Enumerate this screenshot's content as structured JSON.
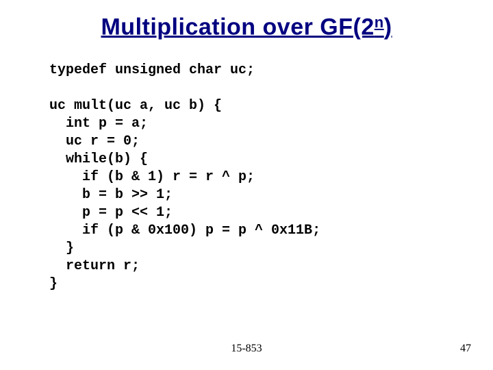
{
  "title": {
    "prefix": "Multiplication over GF(2",
    "sup": "n",
    "suffix": ")"
  },
  "code": {
    "typedef": "typedef unsigned char uc;",
    "blank1": "",
    "func_open": "uc mult(uc a, uc b) {",
    "l1": "  int p = a;",
    "l2": "  uc r = 0;",
    "l3": "  while(b) {",
    "l4": "    if (b & 1) r = r ^ p;",
    "l5": "    b = b >> 1;",
    "l6": "    p = p << 1;",
    "l7": "    if (p & 0x100) p = p ^ 0x11B;",
    "l8": "  }",
    "l9": "  return r;",
    "func_close": "}"
  },
  "footer": {
    "course": "15-853",
    "page": "47"
  }
}
